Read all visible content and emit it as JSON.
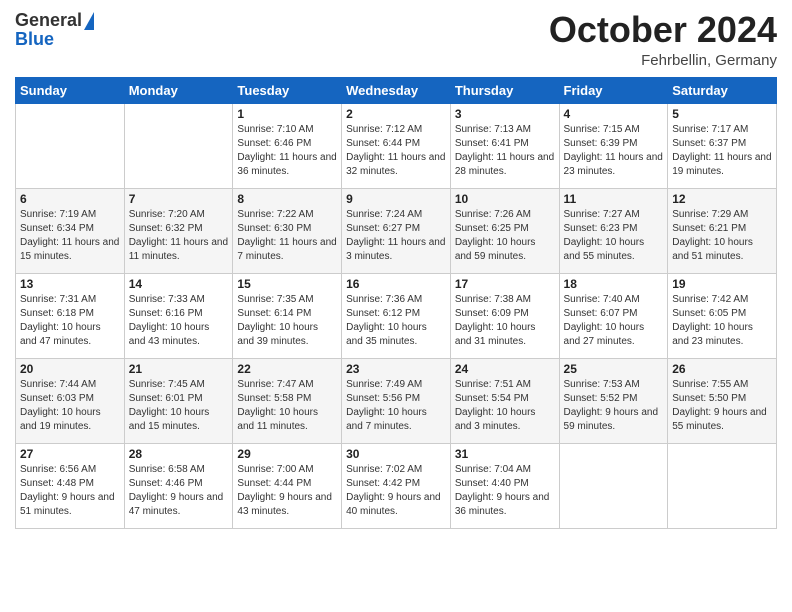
{
  "logo": {
    "general": "General",
    "blue": "Blue"
  },
  "header": {
    "month": "October 2024",
    "location": "Fehrbellin, Germany"
  },
  "weekdays": [
    "Sunday",
    "Monday",
    "Tuesday",
    "Wednesday",
    "Thursday",
    "Friday",
    "Saturday"
  ],
  "weeks": [
    [
      {
        "day": "",
        "sunrise": "",
        "sunset": "",
        "daylight": ""
      },
      {
        "day": "",
        "sunrise": "",
        "sunset": "",
        "daylight": ""
      },
      {
        "day": "1",
        "sunrise": "Sunrise: 7:10 AM",
        "sunset": "Sunset: 6:46 PM",
        "daylight": "Daylight: 11 hours and 36 minutes."
      },
      {
        "day": "2",
        "sunrise": "Sunrise: 7:12 AM",
        "sunset": "Sunset: 6:44 PM",
        "daylight": "Daylight: 11 hours and 32 minutes."
      },
      {
        "day": "3",
        "sunrise": "Sunrise: 7:13 AM",
        "sunset": "Sunset: 6:41 PM",
        "daylight": "Daylight: 11 hours and 28 minutes."
      },
      {
        "day": "4",
        "sunrise": "Sunrise: 7:15 AM",
        "sunset": "Sunset: 6:39 PM",
        "daylight": "Daylight: 11 hours and 23 minutes."
      },
      {
        "day": "5",
        "sunrise": "Sunrise: 7:17 AM",
        "sunset": "Sunset: 6:37 PM",
        "daylight": "Daylight: 11 hours and 19 minutes."
      }
    ],
    [
      {
        "day": "6",
        "sunrise": "Sunrise: 7:19 AM",
        "sunset": "Sunset: 6:34 PM",
        "daylight": "Daylight: 11 hours and 15 minutes."
      },
      {
        "day": "7",
        "sunrise": "Sunrise: 7:20 AM",
        "sunset": "Sunset: 6:32 PM",
        "daylight": "Daylight: 11 hours and 11 minutes."
      },
      {
        "day": "8",
        "sunrise": "Sunrise: 7:22 AM",
        "sunset": "Sunset: 6:30 PM",
        "daylight": "Daylight: 11 hours and 7 minutes."
      },
      {
        "day": "9",
        "sunrise": "Sunrise: 7:24 AM",
        "sunset": "Sunset: 6:27 PM",
        "daylight": "Daylight: 11 hours and 3 minutes."
      },
      {
        "day": "10",
        "sunrise": "Sunrise: 7:26 AM",
        "sunset": "Sunset: 6:25 PM",
        "daylight": "Daylight: 10 hours and 59 minutes."
      },
      {
        "day": "11",
        "sunrise": "Sunrise: 7:27 AM",
        "sunset": "Sunset: 6:23 PM",
        "daylight": "Daylight: 10 hours and 55 minutes."
      },
      {
        "day": "12",
        "sunrise": "Sunrise: 7:29 AM",
        "sunset": "Sunset: 6:21 PM",
        "daylight": "Daylight: 10 hours and 51 minutes."
      }
    ],
    [
      {
        "day": "13",
        "sunrise": "Sunrise: 7:31 AM",
        "sunset": "Sunset: 6:18 PM",
        "daylight": "Daylight: 10 hours and 47 minutes."
      },
      {
        "day": "14",
        "sunrise": "Sunrise: 7:33 AM",
        "sunset": "Sunset: 6:16 PM",
        "daylight": "Daylight: 10 hours and 43 minutes."
      },
      {
        "day": "15",
        "sunrise": "Sunrise: 7:35 AM",
        "sunset": "Sunset: 6:14 PM",
        "daylight": "Daylight: 10 hours and 39 minutes."
      },
      {
        "day": "16",
        "sunrise": "Sunrise: 7:36 AM",
        "sunset": "Sunset: 6:12 PM",
        "daylight": "Daylight: 10 hours and 35 minutes."
      },
      {
        "day": "17",
        "sunrise": "Sunrise: 7:38 AM",
        "sunset": "Sunset: 6:09 PM",
        "daylight": "Daylight: 10 hours and 31 minutes."
      },
      {
        "day": "18",
        "sunrise": "Sunrise: 7:40 AM",
        "sunset": "Sunset: 6:07 PM",
        "daylight": "Daylight: 10 hours and 27 minutes."
      },
      {
        "day": "19",
        "sunrise": "Sunrise: 7:42 AM",
        "sunset": "Sunset: 6:05 PM",
        "daylight": "Daylight: 10 hours and 23 minutes."
      }
    ],
    [
      {
        "day": "20",
        "sunrise": "Sunrise: 7:44 AM",
        "sunset": "Sunset: 6:03 PM",
        "daylight": "Daylight: 10 hours and 19 minutes."
      },
      {
        "day": "21",
        "sunrise": "Sunrise: 7:45 AM",
        "sunset": "Sunset: 6:01 PM",
        "daylight": "Daylight: 10 hours and 15 minutes."
      },
      {
        "day": "22",
        "sunrise": "Sunrise: 7:47 AM",
        "sunset": "Sunset: 5:58 PM",
        "daylight": "Daylight: 10 hours and 11 minutes."
      },
      {
        "day": "23",
        "sunrise": "Sunrise: 7:49 AM",
        "sunset": "Sunset: 5:56 PM",
        "daylight": "Daylight: 10 hours and 7 minutes."
      },
      {
        "day": "24",
        "sunrise": "Sunrise: 7:51 AM",
        "sunset": "Sunset: 5:54 PM",
        "daylight": "Daylight: 10 hours and 3 minutes."
      },
      {
        "day": "25",
        "sunrise": "Sunrise: 7:53 AM",
        "sunset": "Sunset: 5:52 PM",
        "daylight": "Daylight: 9 hours and 59 minutes."
      },
      {
        "day": "26",
        "sunrise": "Sunrise: 7:55 AM",
        "sunset": "Sunset: 5:50 PM",
        "daylight": "Daylight: 9 hours and 55 minutes."
      }
    ],
    [
      {
        "day": "27",
        "sunrise": "Sunrise: 6:56 AM",
        "sunset": "Sunset: 4:48 PM",
        "daylight": "Daylight: 9 hours and 51 minutes."
      },
      {
        "day": "28",
        "sunrise": "Sunrise: 6:58 AM",
        "sunset": "Sunset: 4:46 PM",
        "daylight": "Daylight: 9 hours and 47 minutes."
      },
      {
        "day": "29",
        "sunrise": "Sunrise: 7:00 AM",
        "sunset": "Sunset: 4:44 PM",
        "daylight": "Daylight: 9 hours and 43 minutes."
      },
      {
        "day": "30",
        "sunrise": "Sunrise: 7:02 AM",
        "sunset": "Sunset: 4:42 PM",
        "daylight": "Daylight: 9 hours and 40 minutes."
      },
      {
        "day": "31",
        "sunrise": "Sunrise: 7:04 AM",
        "sunset": "Sunset: 4:40 PM",
        "daylight": "Daylight: 9 hours and 36 minutes."
      },
      {
        "day": "",
        "sunrise": "",
        "sunset": "",
        "daylight": ""
      },
      {
        "day": "",
        "sunrise": "",
        "sunset": "",
        "daylight": ""
      }
    ]
  ]
}
